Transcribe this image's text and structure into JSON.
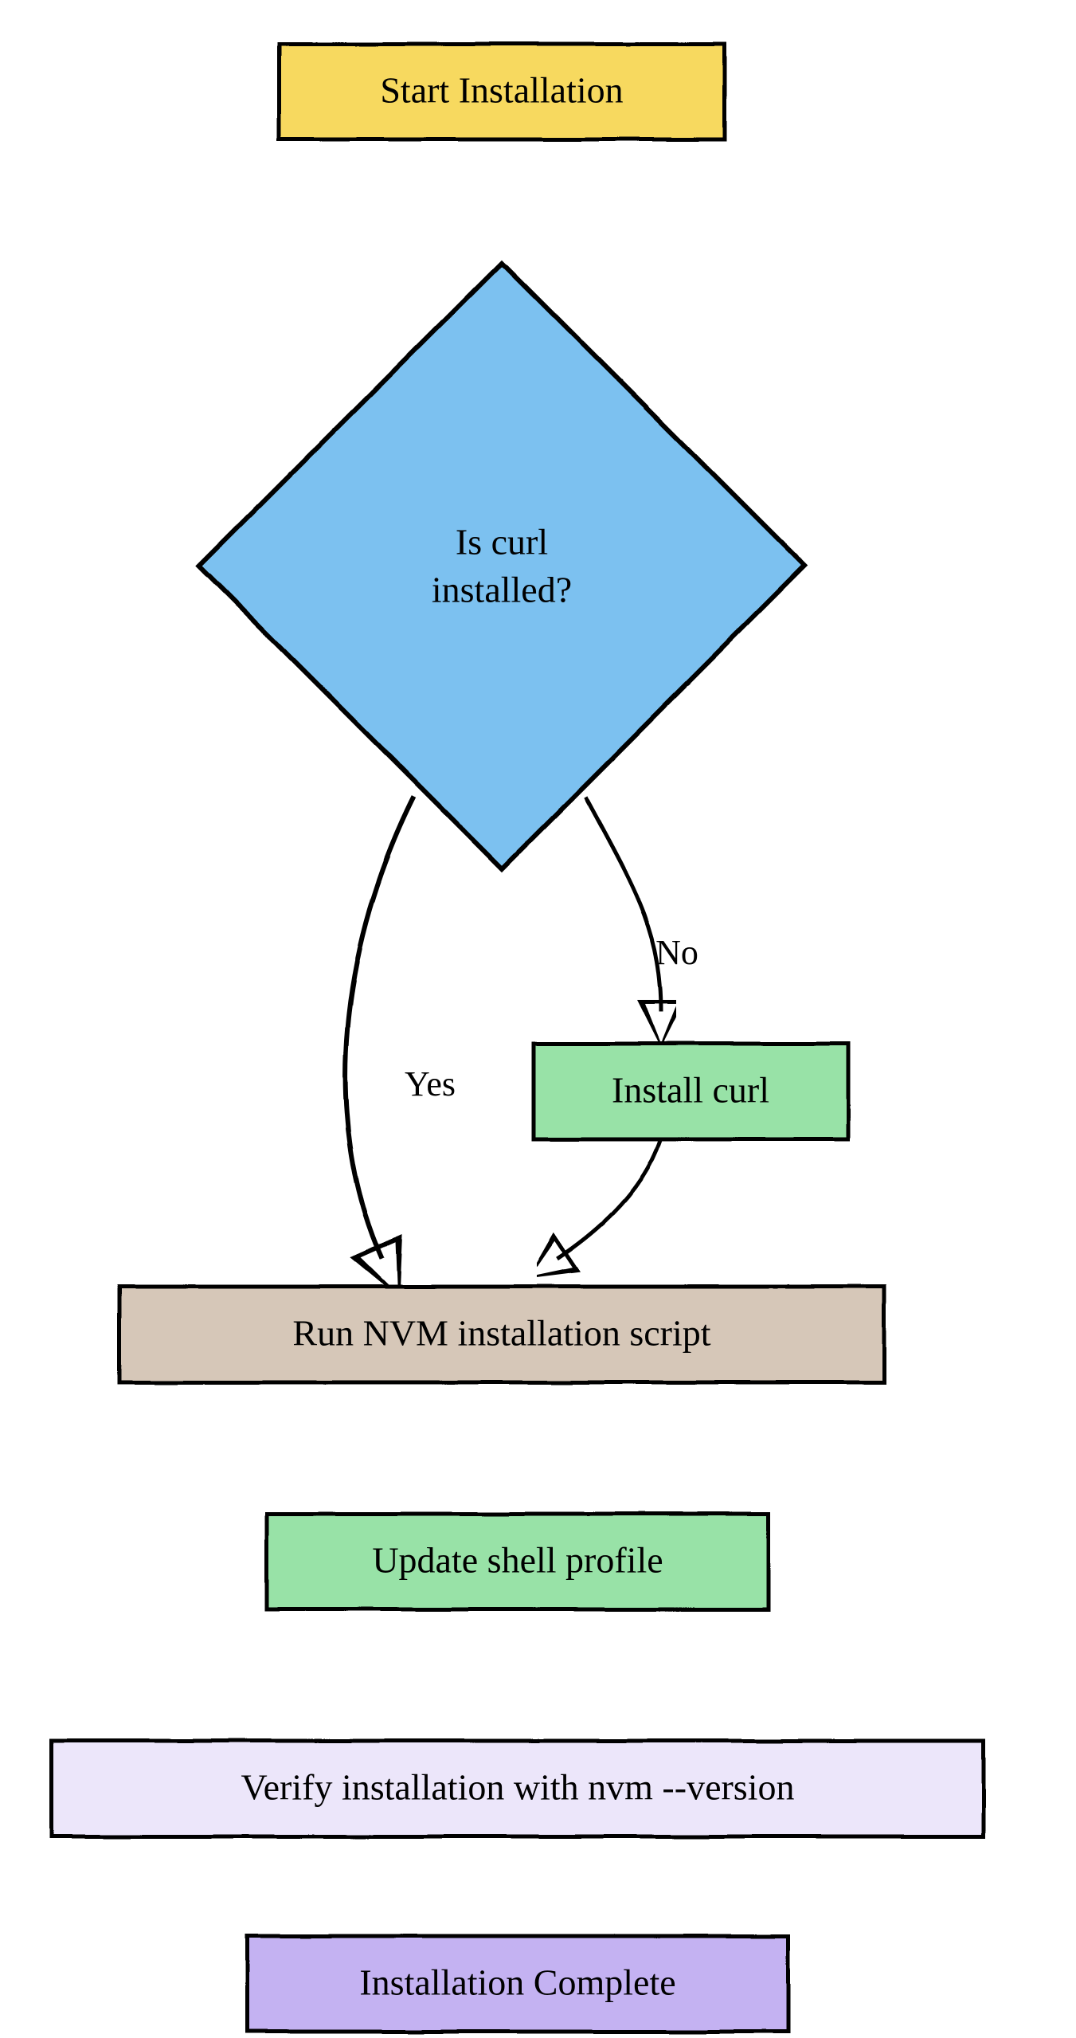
{
  "chart_data": {
    "type": "flowchart",
    "nodes": [
      {
        "id": "start",
        "shape": "rect",
        "label": "Start Installation",
        "fill": "#f7d95f"
      },
      {
        "id": "curlq",
        "shape": "diamond",
        "label": "Is curl installed?",
        "fill": "#7cc1f0"
      },
      {
        "id": "installc",
        "shape": "rect",
        "label": "Install curl",
        "fill": "#98e2a7"
      },
      {
        "id": "runnvm",
        "shape": "rect",
        "label": "Run NVM installation script",
        "fill": "#d6c7b8"
      },
      {
        "id": "update",
        "shape": "rect",
        "label": "Update shell profile",
        "fill": "#98e2a7"
      },
      {
        "id": "verify",
        "shape": "rect",
        "label": "Verify installation with nvm --version",
        "fill": "#ece6fa"
      },
      {
        "id": "done",
        "shape": "rect",
        "label": "Installation Complete",
        "fill": "#c4b2f2"
      }
    ],
    "edges": [
      {
        "from": "start",
        "to": "curlq",
        "label": ""
      },
      {
        "from": "curlq",
        "to": "runnvm",
        "label": "Yes"
      },
      {
        "from": "curlq",
        "to": "installc",
        "label": "No"
      },
      {
        "from": "installc",
        "to": "runnvm",
        "label": ""
      },
      {
        "from": "runnvm",
        "to": "update",
        "label": ""
      },
      {
        "from": "update",
        "to": "verify",
        "label": ""
      },
      {
        "from": "verify",
        "to": "done",
        "label": ""
      }
    ]
  },
  "labels": {
    "start": "Start Installation",
    "curlq_l1": "Is curl",
    "curlq_l2": "installed?",
    "installc": "Install curl",
    "runnvm": "Run NVM installation script",
    "update": "Update shell profile",
    "verify": "Verify installation with nvm --version",
    "done": "Installation Complete",
    "yes": "Yes",
    "no": "No"
  },
  "colors": {
    "yellow": "#f7d95f",
    "blue": "#7cc1f0",
    "green": "#98e2a7",
    "tan": "#d6c7b8",
    "lav": "#ece6fa",
    "purple": "#c4b2f2",
    "stroke": "#000000"
  }
}
